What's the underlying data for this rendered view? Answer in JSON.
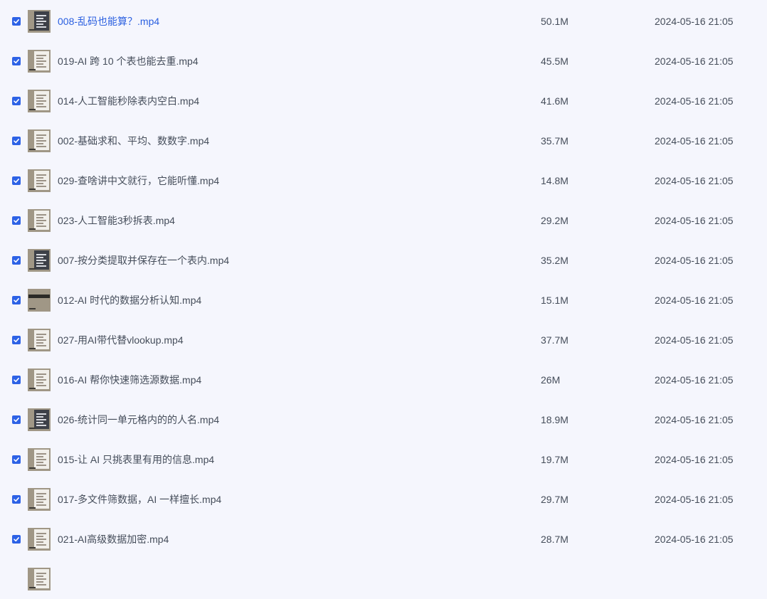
{
  "files": [
    {
      "name": "008-乱码也能算？.mp4",
      "size": "50.1M",
      "modified": "2024-05-16 21:05",
      "checked": true,
      "thumb": "dark-sheet-icon"
    },
    {
      "name": "019-AI 跨 10 个表也能去重.mp4",
      "size": "45.5M",
      "modified": "2024-05-16 21:05",
      "checked": true,
      "thumb": "sheet-icon"
    },
    {
      "name": "014-人工智能秒除表内空白.mp4",
      "size": "41.6M",
      "modified": "2024-05-16 21:05",
      "checked": true,
      "thumb": "sheet-icon"
    },
    {
      "name": "002-基础求和、平均、数数字.mp4",
      "size": "35.7M",
      "modified": "2024-05-16 21:05",
      "checked": true,
      "thumb": "sheet-icon"
    },
    {
      "name": "029-查啥讲中文就行，它能听懂.mp4",
      "size": "14.8M",
      "modified": "2024-05-16 21:05",
      "checked": true,
      "thumb": "sheet-icon"
    },
    {
      "name": "023-人工智能3秒拆表.mp4",
      "size": "29.2M",
      "modified": "2024-05-16 21:05",
      "checked": true,
      "thumb": "sheet-icon"
    },
    {
      "name": "007-按分类提取并保存在一个表内.mp4",
      "size": "35.2M",
      "modified": "2024-05-16 21:05",
      "checked": true,
      "thumb": "dark-sheet-icon"
    },
    {
      "name": "012-AI 时代的数据分析认知.mp4",
      "size": "15.1M",
      "modified": "2024-05-16 21:05",
      "checked": true,
      "thumb": "title-card-icon"
    },
    {
      "name": "027-用AI带代替vlookup.mp4",
      "size": "37.7M",
      "modified": "2024-05-16 21:05",
      "checked": true,
      "thumb": "sheet-icon"
    },
    {
      "name": "016-AI 帮你快速筛选源数据.mp4",
      "size": "26M",
      "modified": "2024-05-16 21:05",
      "checked": true,
      "thumb": "sheet-icon"
    },
    {
      "name": "026-统计同一单元格内的的人名.mp4",
      "size": "18.9M",
      "modified": "2024-05-16 21:05",
      "checked": true,
      "thumb": "dark-sheet-icon"
    },
    {
      "name": "015-让 AI 只挑表里有用的信息.mp4",
      "size": "19.7M",
      "modified": "2024-05-16 21:05",
      "checked": true,
      "thumb": "sheet-icon"
    },
    {
      "name": "017-多文件筛数据，AI 一样擅长.mp4",
      "size": "29.7M",
      "modified": "2024-05-16 21:05",
      "checked": true,
      "thumb": "sheet-icon"
    },
    {
      "name": "021-AI高级数据加密.mp4",
      "size": "28.7M",
      "modified": "2024-05-16 21:05",
      "checked": true,
      "thumb": "sheet-icon"
    }
  ],
  "partial_row_thumb": "sheet-icon",
  "colors": {
    "accent": "#2d62e6",
    "link": "#2a5fe0",
    "text": "#454d5a",
    "background": "#f5f6fd"
  }
}
